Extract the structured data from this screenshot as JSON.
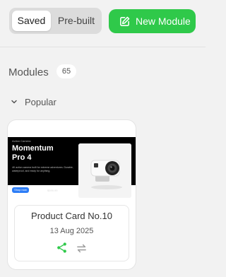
{
  "toolbar": {
    "tabs": [
      {
        "label": "Saved",
        "active": true
      },
      {
        "label": "Pre-built",
        "active": false
      }
    ],
    "new_module_label": "New Module",
    "accent": "#2fc94a"
  },
  "modules": {
    "title": "Modules",
    "count": "65",
    "group": {
      "label": "Popular",
      "expanded": true
    },
    "cards": [
      {
        "name": "Product Card No.10",
        "date": "13 Aug 2025",
        "preview": {
          "eyebrow": "Action Camera",
          "title": "Momentum Pro 4",
          "description": "4K action camera built for extreme adventures. Durable, waterproof, and ready for anything.",
          "button": "Shop now",
          "price": "$599.99"
        },
        "actions": [
          {
            "icon": "share-icon",
            "color": "#2fc94a"
          },
          {
            "icon": "swap-icon",
            "color": "#9a9a9a"
          }
        ]
      }
    ]
  }
}
